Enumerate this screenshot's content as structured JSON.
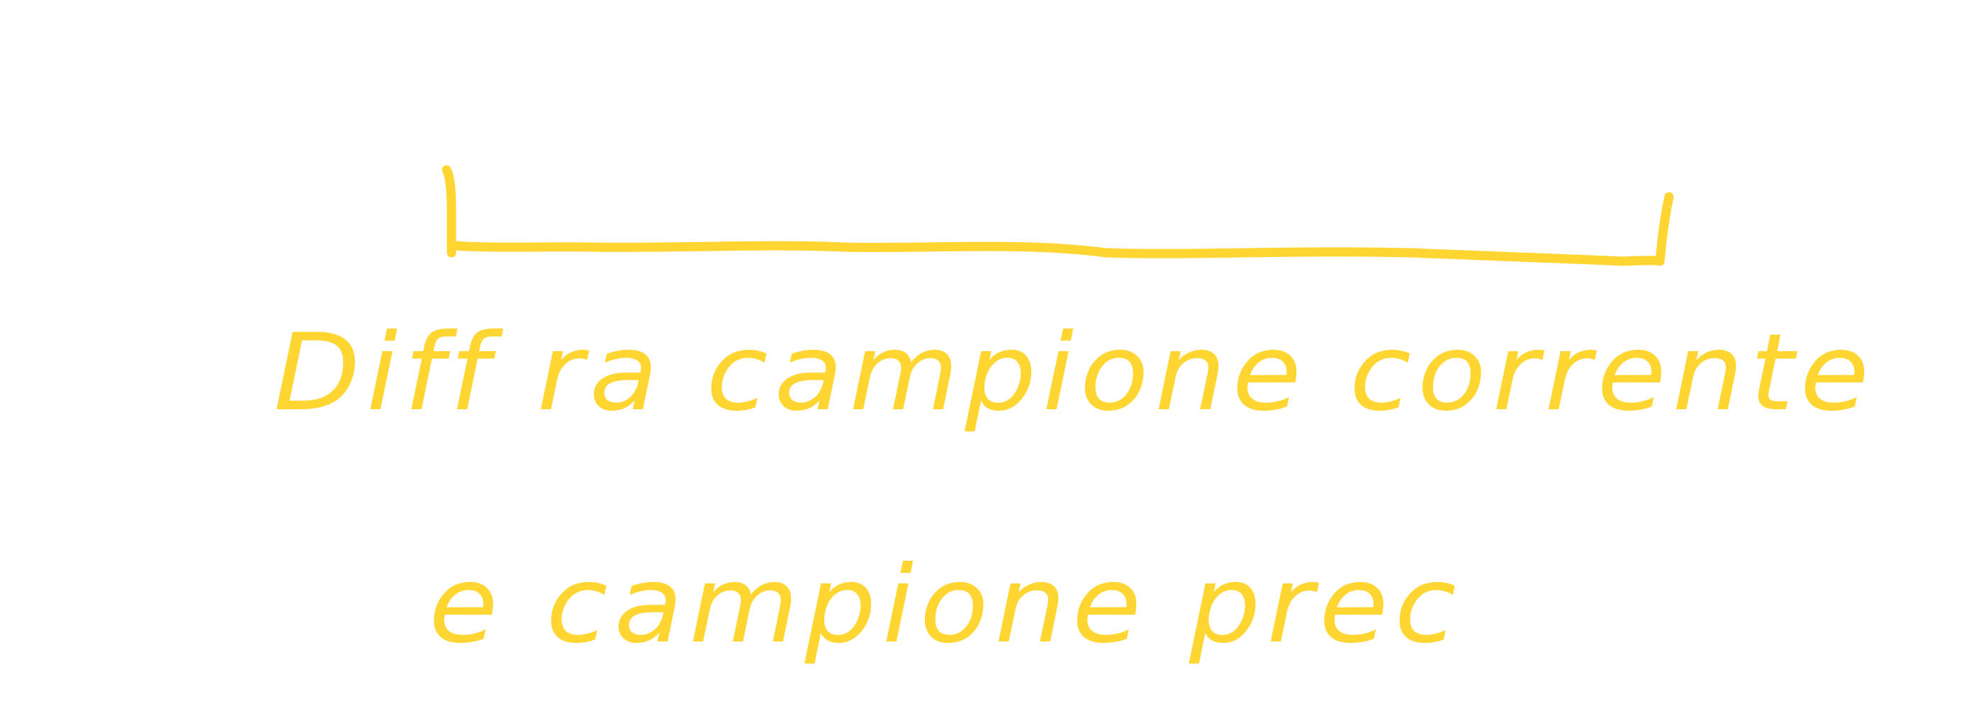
{
  "note": {
    "line_1": "Diff ra campione corrente",
    "line_2": "e campione prec"
  },
  "colors": {
    "ink": "#FFD531",
    "background": "#FFFFFF"
  }
}
